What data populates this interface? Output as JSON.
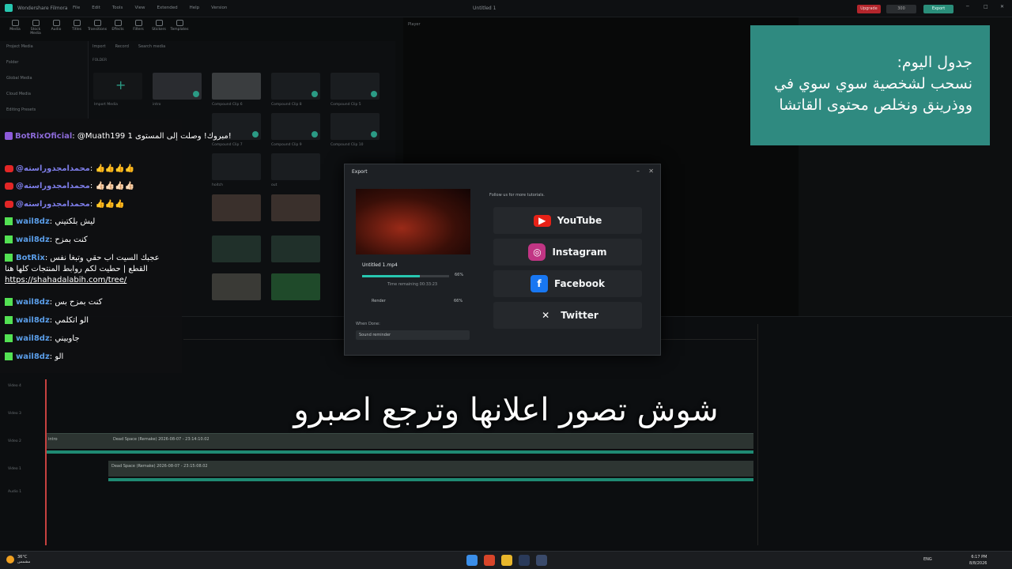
{
  "titlebar": {
    "app_name": "Wondershare Filmora",
    "menus": [
      "File",
      "Edit",
      "Tools",
      "View",
      "Extended",
      "Help",
      "Version"
    ],
    "document": "Untitled 1",
    "upgrade": "Upgrade",
    "credits": "300",
    "export": "Export"
  },
  "toolbar": [
    "Media",
    "Stock Media",
    "Audio",
    "Titles",
    "Transitions",
    "Effects",
    "Filters",
    "Stickers",
    "Templates"
  ],
  "left_panel": [
    "Project Media",
    "Folder",
    "Global Media",
    "Cloud Media",
    "Editing Presets"
  ],
  "media": {
    "import": "Import",
    "record": "Record",
    "search_placeholder": "Search media",
    "folder": "FOLDER",
    "clips": [
      "Import Media",
      "intro",
      "Compound Clip 6",
      "Compound Clip 8",
      "Compound Clip 5",
      "Compound Clip 7",
      "Compound Clip 8",
      "Compound Clip 9",
      "Compound Clip 10",
      "hoitch",
      "out"
    ]
  },
  "player": {
    "label": "Player"
  },
  "overlay_box": {
    "line1": "جدول اليوم:",
    "line2": "نسحب لشخصية سوي سوي في",
    "line3": "ووذرينق ونخلص محتوى القاتشا"
  },
  "chat": [
    {
      "platform": "twitch",
      "user": "BotRixOficial",
      "text": "@Muath199 مبروك! وصلت إلى المستوى 1!",
      "color": "#8c6ad8"
    },
    {
      "platform": "youtube",
      "user": "@محمدامجدوراسته",
      "text": "👍👍👍👍",
      "color": "#7d7de8"
    },
    {
      "platform": "youtube",
      "user": "@محمدامجدوراسته",
      "text": "👍🏻👍🏻👍🏻👍🏻",
      "color": "#7d7de8"
    },
    {
      "platform": "youtube",
      "user": "@محمدامجدوراسته",
      "text": "👍👍👍",
      "color": "#7d7de8"
    },
    {
      "platform": "kick",
      "user": "wail8dz",
      "text": "ليش بلكتيني",
      "color": "#5a9de8"
    },
    {
      "platform": "kick",
      "user": "wail8dz",
      "text": "كنت بمزح",
      "color": "#5a9de8"
    },
    {
      "platform": "kick",
      "user": "BotRix",
      "text": "عجبك السيت اب حقي وتبغا نفس القطع | حطيت لكم روابط المنتجات كلها هنا",
      "link": "https://shahadalabih.com/tree/",
      "color": "#5a9de8"
    },
    {
      "platform": "kick",
      "user": "wail8dz",
      "text": "كنت بمزح بس",
      "color": "#5a9de8"
    },
    {
      "platform": "kick",
      "user": "wail8dz",
      "text": "الو اتكلمي",
      "color": "#5a9de8"
    },
    {
      "platform": "kick",
      "user": "wail8dz",
      "text": "جاوبيني",
      "color": "#5a9de8"
    },
    {
      "platform": "kick",
      "user": "wail8dz",
      "text": "الو",
      "color": "#5a9de8"
    }
  ],
  "export_dialog": {
    "title": "Export",
    "file_name": "Untitled 1.mp4",
    "progress_pct": "66%",
    "progress": 0.66,
    "time_remaining": "Time remaining 00:33:23",
    "render_label": "Render",
    "render_pct": "66%",
    "when_done": "When Done:",
    "when_done_value": "Sound reminder",
    "follow": "Follow us for more tutorials.",
    "socials": [
      "YouTube",
      "Instagram",
      "Facebook",
      "Twitter"
    ]
  },
  "timeline": {
    "tracks": [
      "Video 4",
      "Video 3",
      "Video 2",
      "Video 1",
      "Audio 1"
    ],
    "clip1": "Dead Space (Remake) 2026-08-07 - 23:14:10.02",
    "clip1_intro": "intro",
    "clip2": "Dead Space (Remake) 2026-08-07 - 23:15:08.02"
  },
  "subtitle": "شوش تصور اعلانها وترجع اصبرو",
  "taskbar": {
    "temp": "36°C",
    "weather": "مشمس",
    "lang": "ENG",
    "time": "6:17 PM",
    "date": "8/8/2026"
  }
}
